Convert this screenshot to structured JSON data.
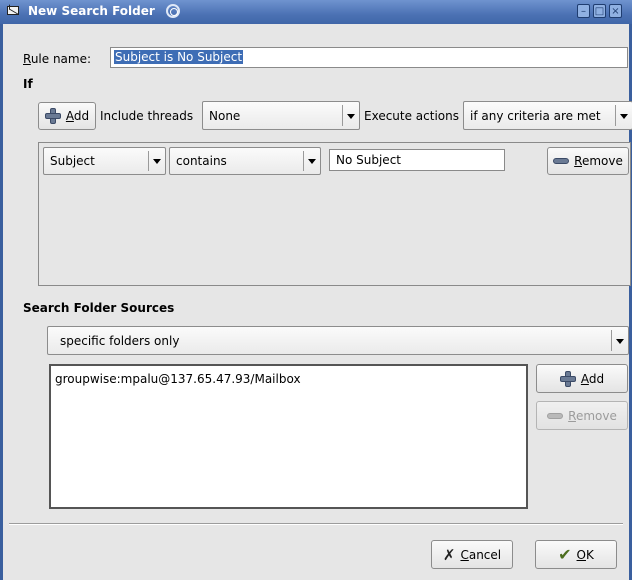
{
  "window": {
    "title": "New Search Folder"
  },
  "rule": {
    "label_prefix": "",
    "label_mnemonic": "R",
    "label_rest": "ule name:",
    "value": "Subject is No Subject"
  },
  "if_section": {
    "heading": "If",
    "add_button": {
      "mnemonic": "A",
      "rest": "dd"
    },
    "include_threads": {
      "label": "Include threads",
      "value": "None"
    },
    "execute_actions": {
      "label": "Execute actions",
      "value": "if any criteria are met"
    },
    "criteria": [
      {
        "field": "Subject",
        "operator": "contains",
        "value": "No Subject",
        "remove_mnemonic": "R",
        "remove_rest": "emove"
      }
    ]
  },
  "sources": {
    "heading": "Search Folder Sources",
    "scope": "specific folders only",
    "folders": [
      "groupwise:mpalu@137.65.47.93/Mailbox"
    ],
    "add_button": {
      "mnemonic": "A",
      "rest": "dd"
    },
    "remove_button": {
      "mnemonic": "R",
      "rest": "emove"
    }
  },
  "footer": {
    "cancel": {
      "mnemonic": "C",
      "rest": "ancel"
    },
    "ok": {
      "mnemonic": "O",
      "rest": "K"
    }
  },
  "colors": {
    "titlebar": "#4c72b4",
    "selection": "#3e6db5",
    "background": "#e6e6e6"
  }
}
